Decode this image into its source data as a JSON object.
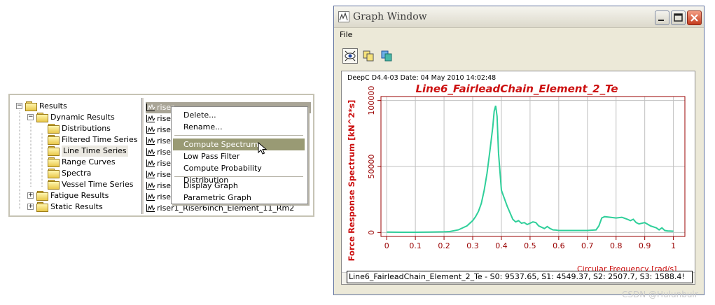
{
  "tree": {
    "items": [
      {
        "label": "Results",
        "level": 0,
        "expander": "−",
        "selected": false
      },
      {
        "label": "Dynamic Results",
        "level": 1,
        "expander": "−",
        "selected": false
      },
      {
        "label": "Distributions",
        "level": 2,
        "expander": "",
        "selected": false
      },
      {
        "label": "Filtered Time Series",
        "level": 2,
        "expander": "",
        "selected": false
      },
      {
        "label": "Line Time Series",
        "level": 2,
        "expander": "",
        "selected": true
      },
      {
        "label": "Range Curves",
        "level": 2,
        "expander": "",
        "selected": false
      },
      {
        "label": "Spectra",
        "level": 2,
        "expander": "",
        "selected": false
      },
      {
        "label": "Vessel Time Series",
        "level": 2,
        "expander": "",
        "selected": false
      },
      {
        "label": "Fatigue Results",
        "level": 1,
        "expander": "+",
        "selected": false
      },
      {
        "label": "Static Results",
        "level": 1,
        "expander": "+",
        "selected": false
      }
    ]
  },
  "list": {
    "items": [
      {
        "label": "riser",
        "highlight": true
      },
      {
        "label": "riser",
        "highlight": false
      },
      {
        "label": "riser",
        "highlight": false
      },
      {
        "label": "riser",
        "highlight": false
      },
      {
        "label": "riser",
        "highlight": false
      },
      {
        "label": "riser",
        "highlight": false
      },
      {
        "label": "riser",
        "highlight": false
      },
      {
        "label": "riser",
        "highlight": false
      },
      {
        "label": "riser",
        "highlight": false
      },
      {
        "label": "riser1_Riser6inch_Element_11_Rm2",
        "highlight": false
      }
    ]
  },
  "context_menu": {
    "groups": [
      [
        "Delete...",
        "Rename..."
      ],
      [
        "Compute Spectrum",
        "Low Pass Filter",
        "Compute Probability Distribution"
      ],
      [
        "Display Graph",
        "Parametric Graph"
      ]
    ],
    "active_item": "Compute Spectrum"
  },
  "graph_window": {
    "title": "Graph Window",
    "menu": {
      "file": "File"
    },
    "toolbar": [
      "view-icon",
      "copy-icon",
      "copy-colored-icon"
    ],
    "header_text": "DeepC D4.4-03 Date: 04 May 2010 14:02:48",
    "legend_text": "Line6_FairleadChain_Element_2_Te - S0: 9537.65,  S1: 4549.37,  S2: 2507.7,  S3: 1588.4!"
  },
  "watermark": "CSDN @Hulunbuir",
  "colors": {
    "title_red": "#cc1010",
    "axis_red": "#990000",
    "series": "#2fcf9a",
    "grid": "#c0c0c0"
  },
  "chart_data": {
    "type": "line",
    "title": "Line6_FairleadChain_Element_2_Te",
    "xlabel": "Circular Frequency [rad/s]",
    "ylabel": "Force Response Spectrum [kN^2*s]",
    "xlim": [
      -0.02,
      1.04
    ],
    "ylim": [
      -3000,
      103000
    ],
    "xticks": [
      "0",
      "0.1",
      "0.2",
      "0.3",
      "0.4",
      "0.5",
      "0.6",
      "0.7",
      "0.8",
      "0.9",
      "1"
    ],
    "xtick_values": [
      0,
      0.1,
      0.2,
      0.3,
      0.4,
      0.5,
      0.6,
      0.7,
      0.8,
      0.9,
      1.0
    ],
    "yticks": [
      "0",
      "50000",
      "100000"
    ],
    "ytick_values": [
      0,
      50000,
      100000
    ],
    "grid": true,
    "series": [
      {
        "x": [
          0.0,
          0.05,
          0.1,
          0.15,
          0.2,
          0.22,
          0.25,
          0.28,
          0.3,
          0.31,
          0.32,
          0.33,
          0.34,
          0.35,
          0.36,
          0.37,
          0.375,
          0.38,
          0.385,
          0.39,
          0.4,
          0.41,
          0.42,
          0.43,
          0.44,
          0.45,
          0.46,
          0.47,
          0.48,
          0.49,
          0.5,
          0.51,
          0.52,
          0.53,
          0.54,
          0.55,
          0.56,
          0.57,
          0.58,
          0.59,
          0.6,
          0.65,
          0.7,
          0.73,
          0.74,
          0.75,
          0.76,
          0.78,
          0.8,
          0.82,
          0.84,
          0.85,
          0.86,
          0.87,
          0.88,
          0.9,
          0.92,
          0.94,
          0.95,
          0.96,
          0.97,
          0.98,
          1.0
        ],
        "y": [
          300,
          200,
          200,
          300,
          500,
          700,
          2000,
          5000,
          9000,
          12000,
          16000,
          22000,
          32000,
          45000,
          62000,
          80000,
          92000,
          96000,
          88000,
          60000,
          32000,
          26000,
          20000,
          15000,
          10000,
          8000,
          9000,
          7000,
          7500,
          6000,
          7000,
          8000,
          7500,
          5000,
          4000,
          3000,
          4500,
          3000,
          2000,
          1800,
          1500,
          1500,
          1500,
          2000,
          5000,
          11000,
          12000,
          11500,
          11000,
          11500,
          10000,
          9000,
          10000,
          7500,
          6500,
          7500,
          5000,
          3500,
          2000,
          3500,
          1500,
          1200,
          1000
        ]
      }
    ]
  }
}
